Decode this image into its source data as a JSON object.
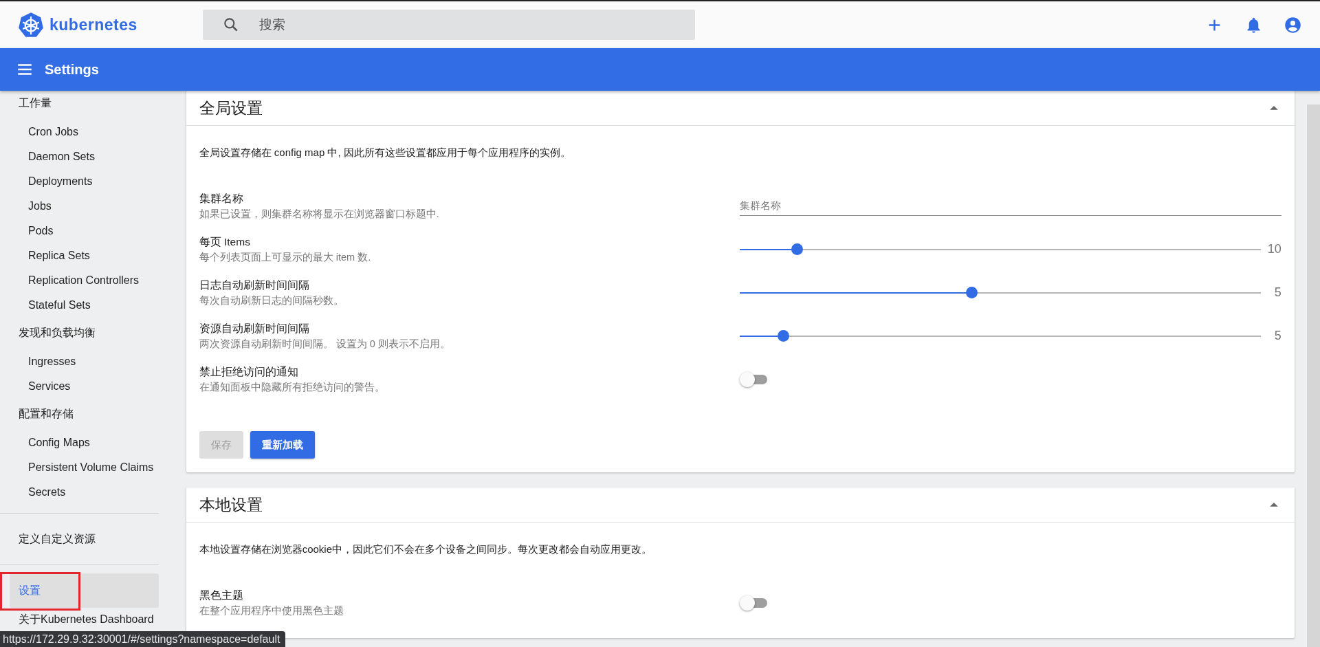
{
  "header": {
    "logo_text": "kubernetes",
    "search": {
      "placeholder": "搜索"
    }
  },
  "toolbar": {
    "title": "Settings"
  },
  "sidebar": {
    "groups": [
      {
        "title": "工作量",
        "items": [
          {
            "label": "Cron Jobs",
            "selected": false
          },
          {
            "label": "Daemon Sets",
            "selected": false
          },
          {
            "label": "Deployments",
            "selected": false
          },
          {
            "label": "Jobs",
            "selected": false
          },
          {
            "label": "Pods",
            "selected": false
          },
          {
            "label": "Replica Sets",
            "selected": false
          },
          {
            "label": "Replication Controllers",
            "selected": false
          },
          {
            "label": "Stateful Sets",
            "selected": false
          }
        ]
      },
      {
        "title": "发现和负载均衡",
        "items": [
          {
            "label": "Ingresses",
            "selected": false
          },
          {
            "label": "Services",
            "selected": false
          }
        ]
      },
      {
        "title": "配置和存储",
        "items": [
          {
            "label": "Config Maps",
            "selected": false
          },
          {
            "label": "Persistent Volume Claims",
            "selected": false
          },
          {
            "label": "Secrets",
            "selected": false
          }
        ]
      }
    ],
    "bottom_items": [
      {
        "label": "定义自定义资源",
        "selected": false,
        "highlighted": false
      },
      {
        "label": "设置",
        "selected": true,
        "highlighted": true
      },
      {
        "label": "关于Kubernetes Dashboard",
        "selected": false,
        "highlighted": false
      }
    ]
  },
  "cards": [
    {
      "title": "全局设置",
      "expanded": true,
      "description": "全局设置存储在 config map 中, 因此所有这些设置都应用于每个应用程序的实例。",
      "settings": [
        {
          "kind": "text",
          "label": "集群名称",
          "hint": "如果已设置，则集群名称将显示在浏览器窗口标题中.",
          "placeholder": "集群名称"
        },
        {
          "kind": "slider",
          "label": "每页 Items",
          "hint": "每个列表页面上可显示的最大 item 数.",
          "level": 0.11,
          "reading": "10"
        },
        {
          "kind": "slider",
          "label": "日志自动刷新时间间隔",
          "hint": "每次自动刷新日志的间隔秒数。",
          "level": 0.445,
          "reading": "5"
        },
        {
          "kind": "slider",
          "label": "资源自动刷新时间间隔",
          "hint": "两次资源自动刷新时间间隔。 设置为 0 则表示不启用。",
          "level": 0.083,
          "reading": "5"
        },
        {
          "kind": "toggle",
          "label": "禁止拒绝访问的通知",
          "hint": "在通知面板中隐藏所有拒绝访问的警告。",
          "on": false
        }
      ],
      "buttons": [
        {
          "label": "保存",
          "disabled": true
        },
        {
          "label": "重新加载",
          "disabled": false
        }
      ]
    },
    {
      "title": "本地设置",
      "expanded": true,
      "description": "本地设置存储在浏览器cookie中，因此它们不会在多个设备之间同步。每次更改都会自动应用更改。",
      "settings": [
        {
          "kind": "toggle",
          "label": "黑色主题",
          "hint": "在整个应用程序中使用黑色主题",
          "on": false
        }
      ]
    }
  ],
  "status_url": "https://172.29.9.32:30001/#/settings?namespace=default"
}
